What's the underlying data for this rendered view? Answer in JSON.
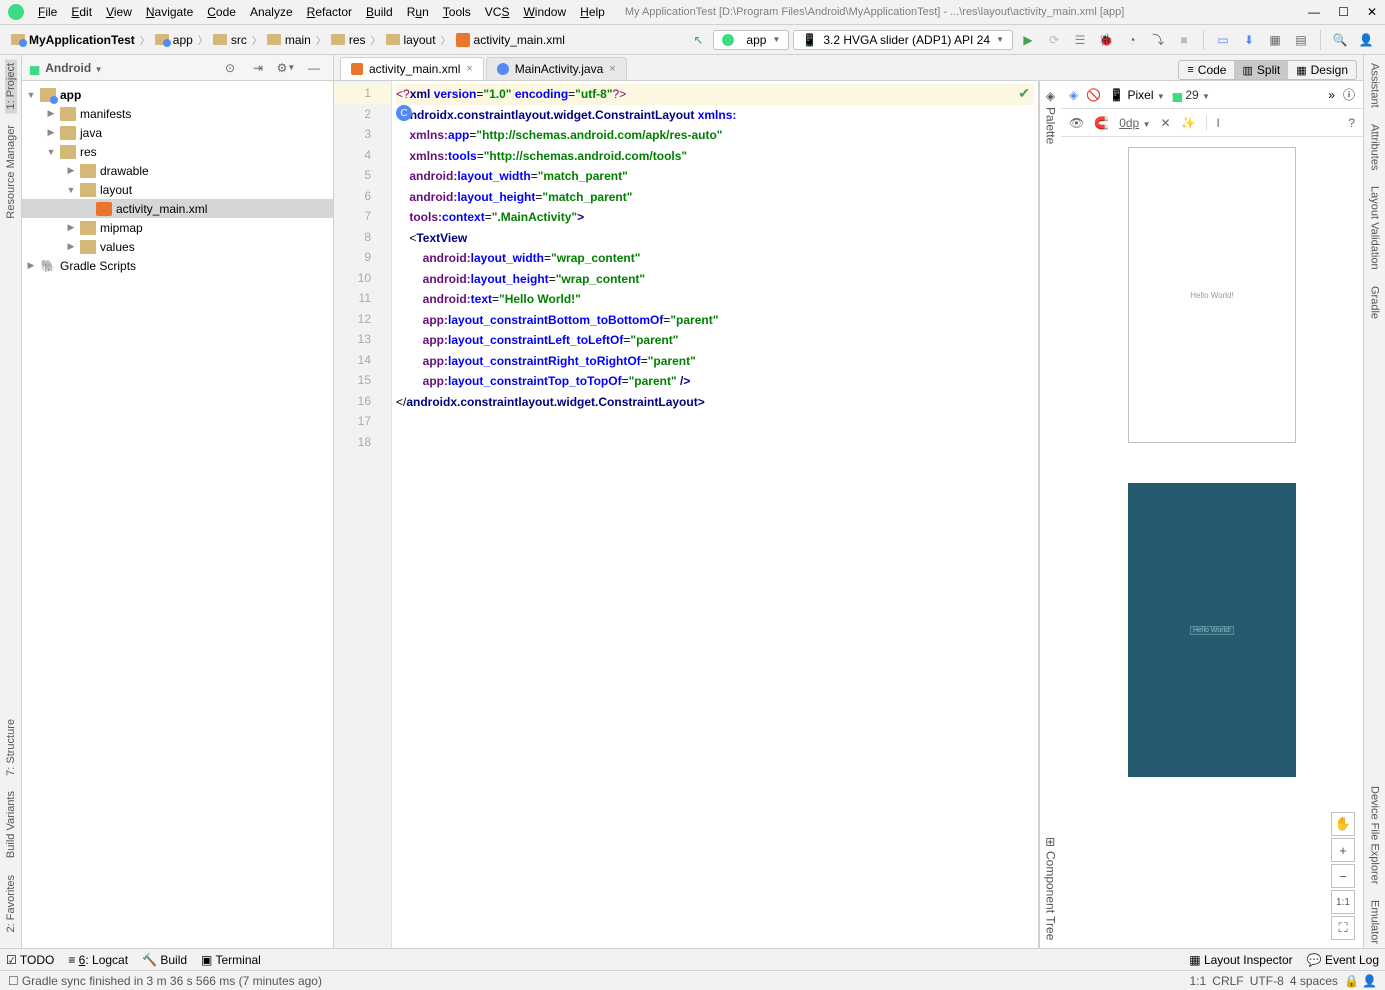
{
  "window": {
    "title": "My ApplicationTest [D:\\Program Files\\Android\\MyApplicationTest] - ...\\res\\layout\\activity_main.xml [app]"
  },
  "menu": {
    "file": "File",
    "edit": "Edit",
    "view": "View",
    "navigate": "Navigate",
    "code": "Code",
    "analyze": "Analyze",
    "refactor": "Refactor",
    "build": "Build",
    "run": "Run",
    "tools": "Tools",
    "vcs": "VCS",
    "window": "Window",
    "help": "Help"
  },
  "breadcrumbs": [
    "MyApplicationTest",
    "app",
    "src",
    "main",
    "res",
    "layout",
    "activity_main.xml"
  ],
  "run_config": {
    "name": "app"
  },
  "device_dropdown": {
    "label": "3.2  HVGA slider (ADP1) API 24"
  },
  "project": {
    "view": "Android",
    "root": "app",
    "nodes": {
      "manifests": "manifests",
      "java": "java",
      "res": "res",
      "drawable": "drawable",
      "layout": "layout",
      "activity_main": "activity_main.xml",
      "mipmap": "mipmap",
      "values": "values",
      "gradle": "Gradle Scripts"
    }
  },
  "tabs": {
    "t1": "activity_main.xml",
    "t2": "MainActivity.java"
  },
  "view_modes": {
    "code": "Code",
    "split": "Split",
    "design": "Design"
  },
  "design": {
    "device": "Pixel",
    "api": "29",
    "hello": "Hello World!",
    "bp_hello": "Hello World!",
    "zoom_11": "1:1",
    "dp": "0dp"
  },
  "palette_label": "Palette",
  "comp_tree_label": "Component Tree",
  "left_tools": {
    "project": "1: Project",
    "resmgr": "Resource Manager",
    "structure": "7: Structure",
    "buildvar": "Build Variants",
    "favorites": "2: Favorites"
  },
  "right_tools": {
    "assistant": "Assistant",
    "attributes": "Attributes",
    "layoutval": "Layout Validation",
    "gradle": "Gradle",
    "devexplorer": "Device File Explorer",
    "emulator": "Emulator"
  },
  "bottom": {
    "todo": "TODO",
    "logcat": "6: Logcat",
    "build": "Build",
    "terminal": "Terminal",
    "layout_inspector": "Layout Inspector",
    "event_log": "Event Log"
  },
  "status": {
    "msg": "Gradle sync finished in 3 m 36 s 566 ms (7 minutes ago)",
    "pos": "1:1",
    "le": "CRLF",
    "enc": "UTF-8",
    "indent": "4 spaces"
  },
  "code_lines": [
    {
      "n": 1,
      "seg": [
        [
          "k-pi",
          "<?"
        ],
        [
          "k-tag",
          "xml "
        ],
        [
          "k-attr",
          "version"
        ],
        [
          "",
          "="
        ],
        [
          "k-str",
          "\"1.0\""
        ],
        [
          "",
          " "
        ],
        [
          "k-attr",
          "encoding"
        ],
        [
          "",
          "="
        ],
        [
          "k-str",
          "\"utf-8\""
        ],
        [
          "k-pi",
          "?>"
        ]
      ],
      "hl": true
    },
    {
      "n": 2,
      "seg": [
        [
          "",
          "<"
        ],
        [
          "k-tag",
          "androidx.constraintlayout.widget.ConstraintLayout "
        ],
        [
          "k-attr",
          "xmlns:"
        ]
      ],
      "icon": "C"
    },
    {
      "n": 3,
      "seg": [
        [
          "",
          "    "
        ],
        [
          "k-ns",
          "xmlns:"
        ],
        [
          "k-attr",
          "app"
        ],
        [
          "",
          "="
        ],
        [
          "k-str",
          "\"http://schemas.android.com/apk/res-auto\""
        ]
      ]
    },
    {
      "n": 4,
      "seg": [
        [
          "",
          "    "
        ],
        [
          "k-ns",
          "xmlns:"
        ],
        [
          "k-attr",
          "tools"
        ],
        [
          "",
          "="
        ],
        [
          "k-str",
          "\"http://schemas.android.com/tools\""
        ]
      ]
    },
    {
      "n": 5,
      "seg": [
        [
          "",
          "    "
        ],
        [
          "k-ns",
          "android:"
        ],
        [
          "k-attr",
          "layout_width"
        ],
        [
          "",
          "="
        ],
        [
          "k-str",
          "\"match_parent\""
        ]
      ]
    },
    {
      "n": 6,
      "seg": [
        [
          "",
          "    "
        ],
        [
          "k-ns",
          "android:"
        ],
        [
          "k-attr",
          "layout_height"
        ],
        [
          "",
          "="
        ],
        [
          "k-str",
          "\"match_parent\""
        ]
      ]
    },
    {
      "n": 7,
      "seg": [
        [
          "",
          "    "
        ],
        [
          "k-ns",
          "tools:"
        ],
        [
          "k-attr",
          "context"
        ],
        [
          "",
          "="
        ],
        [
          "k-str",
          "\".MainActivity\""
        ],
        [
          "k-tag",
          ">"
        ]
      ]
    },
    {
      "n": 8,
      "seg": [
        [
          "",
          ""
        ]
      ]
    },
    {
      "n": 9,
      "seg": [
        [
          "",
          "    <"
        ],
        [
          "k-tag",
          "TextView"
        ]
      ]
    },
    {
      "n": 10,
      "seg": [
        [
          "",
          "        "
        ],
        [
          "k-ns",
          "android:"
        ],
        [
          "k-attr",
          "layout_width"
        ],
        [
          "",
          "="
        ],
        [
          "k-str",
          "\"wrap_content\""
        ]
      ]
    },
    {
      "n": 11,
      "seg": [
        [
          "",
          "        "
        ],
        [
          "k-ns",
          "android:"
        ],
        [
          "k-attr",
          "layout_height"
        ],
        [
          "",
          "="
        ],
        [
          "k-str",
          "\"wrap_content\""
        ]
      ]
    },
    {
      "n": 12,
      "seg": [
        [
          "",
          "        "
        ],
        [
          "k-ns",
          "android:"
        ],
        [
          "k-attr",
          "text"
        ],
        [
          "",
          "="
        ],
        [
          "k-str",
          "\"Hello World!\""
        ]
      ]
    },
    {
      "n": 13,
      "seg": [
        [
          "",
          "        "
        ],
        [
          "k-ns",
          "app:"
        ],
        [
          "k-attr",
          "layout_constraintBottom_toBottomOf"
        ],
        [
          "",
          "="
        ],
        [
          "k-str",
          "\"parent\""
        ]
      ]
    },
    {
      "n": 14,
      "seg": [
        [
          "",
          "        "
        ],
        [
          "k-ns",
          "app:"
        ],
        [
          "k-attr",
          "layout_constraintLeft_toLeftOf"
        ],
        [
          "",
          "="
        ],
        [
          "k-str",
          "\"parent\""
        ]
      ]
    },
    {
      "n": 15,
      "seg": [
        [
          "",
          "        "
        ],
        [
          "k-ns",
          "app:"
        ],
        [
          "k-attr",
          "layout_constraintRight_toRightOf"
        ],
        [
          "",
          "="
        ],
        [
          "k-str",
          "\"parent\""
        ]
      ]
    },
    {
      "n": 16,
      "seg": [
        [
          "",
          "        "
        ],
        [
          "k-ns",
          "app:"
        ],
        [
          "k-attr",
          "layout_constraintTop_toTopOf"
        ],
        [
          "",
          "="
        ],
        [
          "k-str",
          "\"parent\""
        ],
        [
          "",
          " "
        ],
        [
          "k-tag",
          "/>"
        ]
      ]
    },
    {
      "n": 17,
      "seg": [
        [
          "",
          ""
        ]
      ]
    },
    {
      "n": 18,
      "seg": [
        [
          "",
          "</"
        ],
        [
          "k-tag",
          "androidx.constraintlayout.widget.ConstraintLayout"
        ],
        [
          "k-tag",
          ">"
        ]
      ]
    }
  ]
}
